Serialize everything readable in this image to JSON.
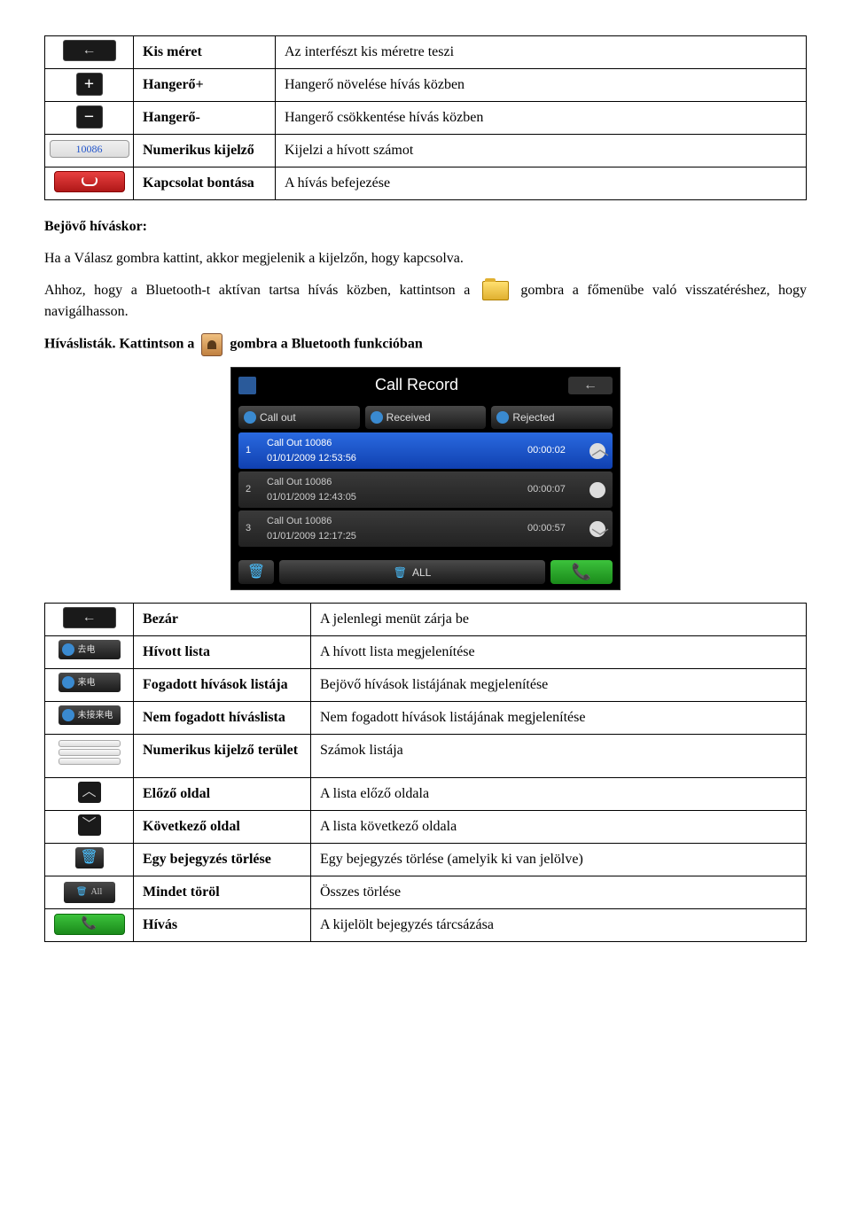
{
  "table1": {
    "rows": [
      {
        "name": "Kis méret",
        "desc": "Az interfészt kis méretre teszi"
      },
      {
        "name": "Hangerő+",
        "desc": "Hangerő növelése hívás közben"
      },
      {
        "name": "Hangerő-",
        "desc": "Hangerő csökkentése hívás közben"
      },
      {
        "name": "Numerikus kijelző",
        "desc": "Kijelzi a hívott számot"
      },
      {
        "name": "Kapcsolat bontása",
        "desc": "A hívás befejezése"
      }
    ],
    "numeric_sample": "10086"
  },
  "section1": {
    "heading": "Bejövő híváskor:",
    "p1": "Ha a Válasz gombra kattint, akkor megjelenik a kijelzőn, hogy kapcsolva.",
    "p2a": "Ahhoz, hogy a Bluetooth-t aktívan tartsa hívás közben, kattintson a ",
    "p2b": " gombra a főmenübe való visszatéréshez, hogy navigálhasson."
  },
  "section2": {
    "heading_a": "Híváslisták. Kattintson a ",
    "heading_b": " gombra a Bluetooth funkcióban"
  },
  "screenshot": {
    "title": "Call Record",
    "tabs": [
      "Call out",
      "Received",
      "Rejected"
    ],
    "rows": [
      {
        "idx": "1",
        "l1": "Call Out  10086",
        "l2": "01/01/2009  12:53:56",
        "dur": "00:00:02"
      },
      {
        "idx": "2",
        "l1": "Call Out  10086",
        "l2": "01/01/2009  12:43:05",
        "dur": "00:00:07"
      },
      {
        "idx": "3",
        "l1": "Call Out  10086",
        "l2": "01/01/2009  12:17:25",
        "dur": "00:00:57"
      }
    ],
    "all_label": "ALL"
  },
  "table2": {
    "rows": [
      {
        "name": "Bezár",
        "desc": "A jelenlegi menüt zárja be"
      },
      {
        "name": "Hívott lista",
        "desc": "A hívott lista megjelenítése"
      },
      {
        "name": "Fogadott hívások listája",
        "desc": "Bejövő hívások listájának megjelenítése"
      },
      {
        "name": "Nem fogadott híváslista",
        "desc": "Nem fogadott hívások listájának megjelenítése"
      },
      {
        "name": "Numerikus kijelző terület",
        "desc": "Számok listája"
      },
      {
        "name": "Előző oldal",
        "desc": "A lista előző oldala"
      },
      {
        "name": "Következő oldal",
        "desc": "A lista következő oldala"
      },
      {
        "name": "Egy bejegyzés törlése",
        "desc": "Egy bejegyzés törlése (amelyik ki van jelölve)"
      },
      {
        "name": "Mindet töröl",
        "desc": "Összes törlése"
      },
      {
        "name": "Hívás",
        "desc": "A kijelölt bejegyzés tárcsázása"
      }
    ],
    "icon_labels": {
      "callout": "去电",
      "received": "来电",
      "rejected": "未接来电",
      "all": "All"
    }
  }
}
